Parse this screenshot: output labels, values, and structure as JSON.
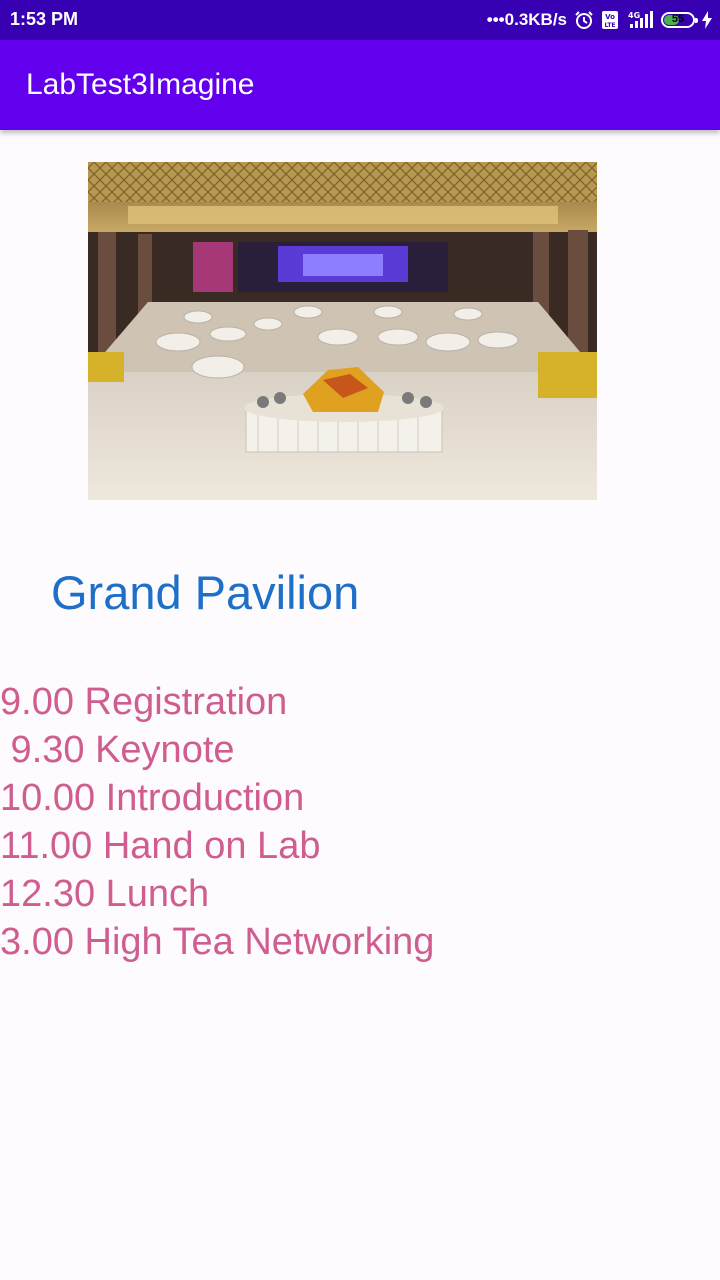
{
  "status_bar": {
    "time": "1:53 PM",
    "network_speed": "•••0.3KB/s",
    "battery_level": "55",
    "battery_fraction": 0.55,
    "icons": [
      "alarm-icon",
      "volte-icon",
      "signal-4g-icon",
      "battery-icon",
      "charging-icon"
    ]
  },
  "app_bar": {
    "title": "LabTest3Imagine",
    "color": "#6200ee",
    "status_color": "#3700b3"
  },
  "venue": {
    "image_subject": "banquet hall with dining tables",
    "title": "Grand Pavilion",
    "title_color": "#1e6fc8"
  },
  "schedule": {
    "color": "#d05d8f",
    "items": [
      "9.00 Registration",
      " 9.30 Keynote",
      "10.00 Introduction",
      "11.00 Hand on Lab",
      "12.30 Lunch",
      "3.00 High Tea Networking"
    ]
  }
}
